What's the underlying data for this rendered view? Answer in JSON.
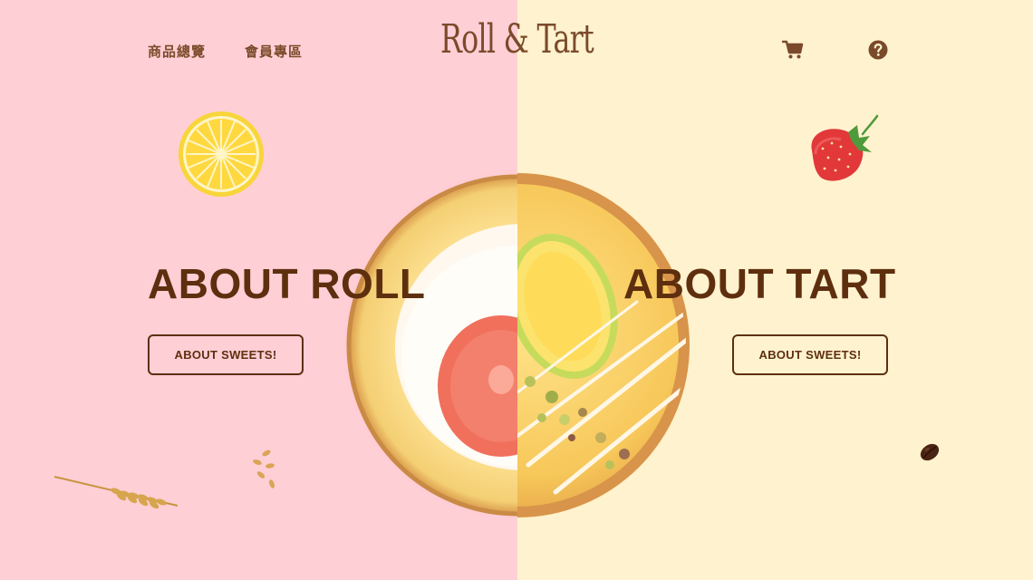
{
  "header": {
    "nav": [
      {
        "label": "商品總覽"
      },
      {
        "label": "會員專區"
      }
    ],
    "logo_text": "Roll & Tart",
    "icons": [
      "cart-icon",
      "help-icon"
    ]
  },
  "sections": {
    "roll": {
      "title": "ABOUT ROLL",
      "button_label": "ABOUT SWEETS!"
    },
    "tart": {
      "title": "ABOUT TART",
      "button_label": "ABOUT SWEETS!"
    }
  },
  "colors": {
    "left_background": "#ffcfd6",
    "right_background": "#fff2cf",
    "text_brown": "#5e2f0e",
    "nav_brown": "#7a4a2a"
  }
}
